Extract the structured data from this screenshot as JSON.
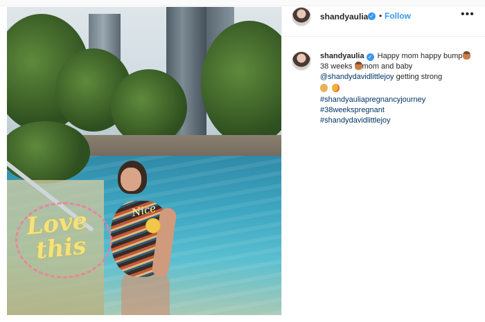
{
  "post": {
    "username": "shandyaulia",
    "verified_glyph": "✓",
    "follow_label": "Follow",
    "dot": "•",
    "more_label": "•••"
  },
  "caption": {
    "username": "shandyaulia",
    "line1": "Happy mom happy bump",
    "line2": "38 weeks",
    "line2b": "mom and baby",
    "mention": "@shandydavidlittlejoy",
    "mention_tail": " getting strong",
    "hashtags": [
      "#shandyauliapregnancyjourney",
      "#38weekspregnant",
      "#shandydavidlittlejoy"
    ]
  },
  "stickers": {
    "nice": "Nice",
    "love_line1": "Love",
    "love_line2": "this"
  },
  "icons": {
    "verified": "verified-badge-icon",
    "more": "more-options-icon",
    "pregnant": "pregnant-woman-emoji",
    "muscle": "flexed-biceps-emoji",
    "blush": "smiling-face-emoji"
  },
  "colors": {
    "link": "#003569",
    "follow": "#3897f0",
    "text": "#262626"
  }
}
